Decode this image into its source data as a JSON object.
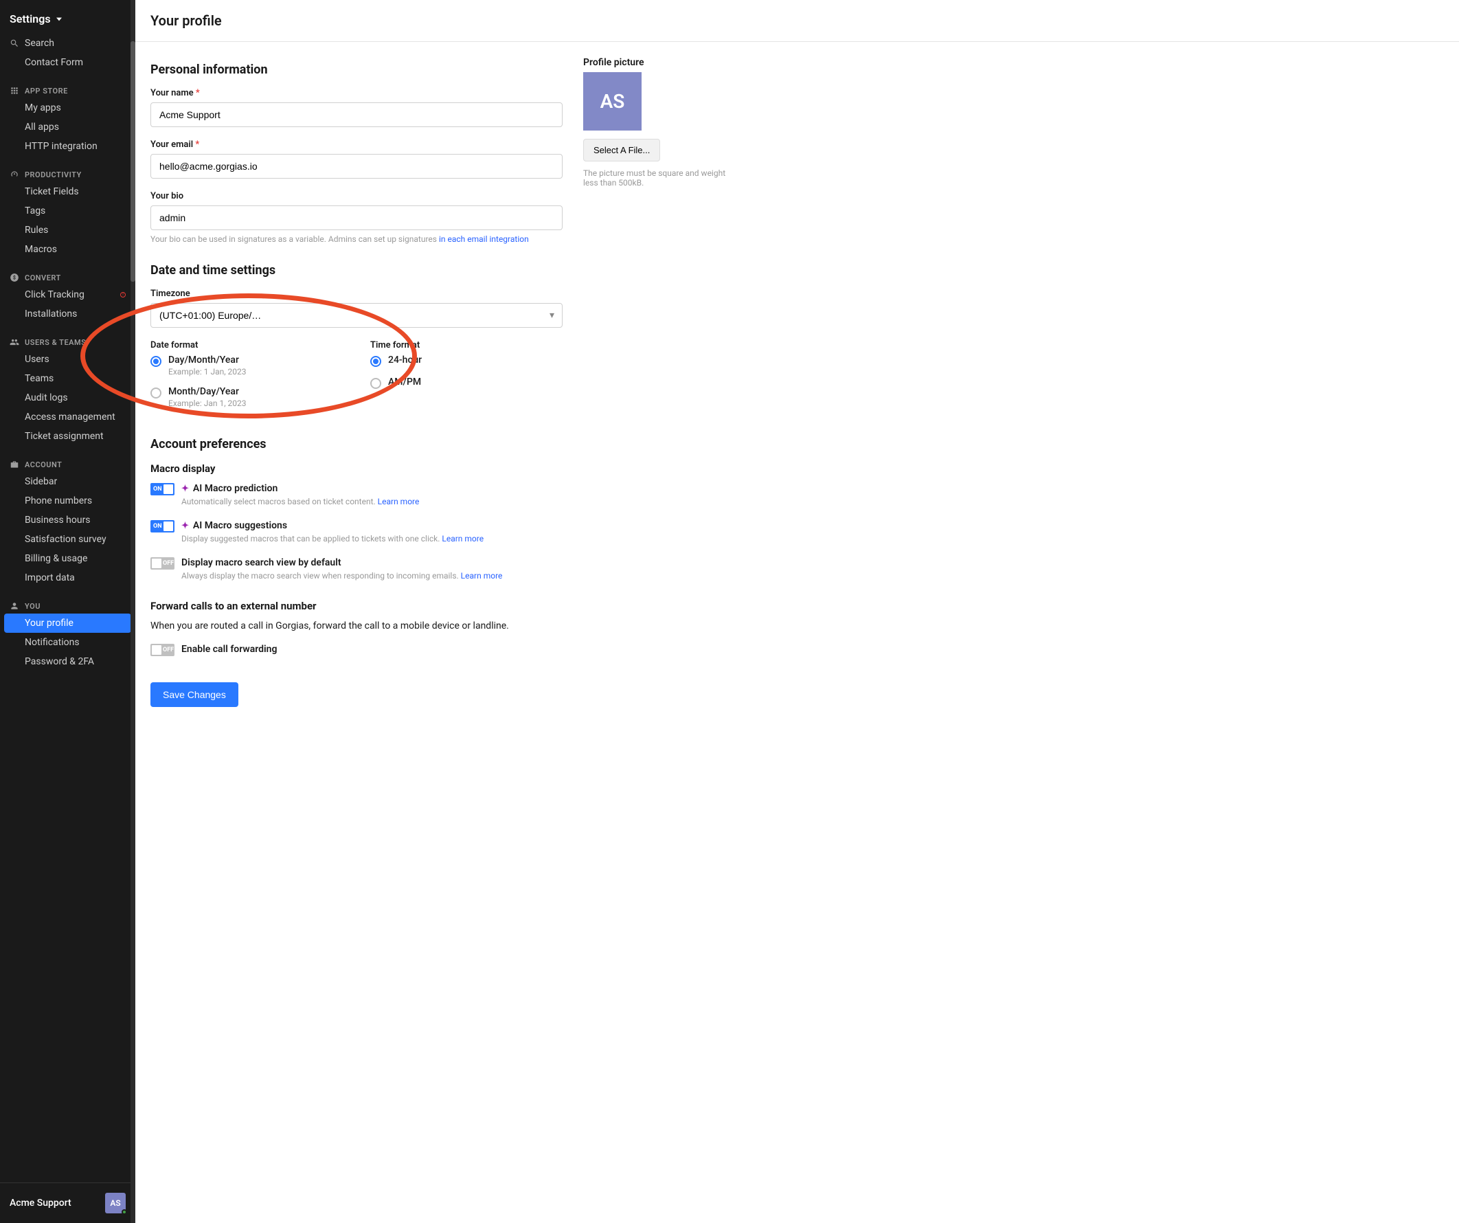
{
  "sidebar": {
    "title": "Settings",
    "top_items": [
      {
        "label": "Search"
      },
      {
        "label": "Contact Form"
      }
    ],
    "sections": [
      {
        "label": "APP STORE",
        "items": [
          {
            "label": "My apps"
          },
          {
            "label": "All apps"
          },
          {
            "label": "HTTP integration"
          }
        ]
      },
      {
        "label": "PRODUCTIVITY",
        "items": [
          {
            "label": "Ticket Fields"
          },
          {
            "label": "Tags"
          },
          {
            "label": "Rules"
          },
          {
            "label": "Macros"
          }
        ]
      },
      {
        "label": "CONVERT",
        "items": [
          {
            "label": "Click Tracking",
            "badge": true
          },
          {
            "label": "Installations"
          }
        ]
      },
      {
        "label": "USERS & TEAMS",
        "items": [
          {
            "label": "Users"
          },
          {
            "label": "Teams"
          },
          {
            "label": "Audit logs"
          },
          {
            "label": "Access management"
          },
          {
            "label": "Ticket assignment"
          }
        ]
      },
      {
        "label": "ACCOUNT",
        "items": [
          {
            "label": "Sidebar"
          },
          {
            "label": "Phone numbers"
          },
          {
            "label": "Business hours"
          },
          {
            "label": "Satisfaction survey"
          },
          {
            "label": "Billing & usage"
          },
          {
            "label": "Import data"
          }
        ]
      },
      {
        "label": "YOU",
        "items": [
          {
            "label": "Your profile",
            "active": true
          },
          {
            "label": "Notifications"
          },
          {
            "label": "Password & 2FA"
          }
        ]
      }
    ],
    "footer": {
      "org_name": "Acme Support",
      "avatar_initials": "AS"
    }
  },
  "page": {
    "title": "Your profile",
    "personal_info": {
      "heading": "Personal information",
      "name_label": "Your name",
      "name_value": "Acme Support",
      "email_label": "Your email",
      "email_value": "hello@acme.gorgias.io",
      "bio_label": "Your bio",
      "bio_value": "admin",
      "bio_hint_prefix": "Your bio can be used in signatures as a variable. Admins can set up signatures ",
      "bio_hint_link": "in each email integration"
    },
    "date_time": {
      "heading": "Date and time settings",
      "timezone_label": "Timezone",
      "timezone_value": "(UTC+01:00) Europe/…",
      "date_format_label": "Date format",
      "date_opt1_label": "Day/Month/Year",
      "date_opt1_example": "Example: 1 Jan, 2023",
      "date_opt2_label": "Month/Day/Year",
      "date_opt2_example": "Example: Jan 1, 2023",
      "time_format_label": "Time format",
      "time_opt1_label": "24-hour",
      "time_opt2_label": "AM/PM"
    },
    "account_prefs": {
      "heading": "Account preferences",
      "macro_display_heading": "Macro display",
      "toggles": [
        {
          "on": true,
          "ai": true,
          "title": "AI Macro prediction",
          "desc_prefix": "Automatically select macros based on ticket content. ",
          "learn_more": "Learn more"
        },
        {
          "on": true,
          "ai": true,
          "title": "AI Macro suggestions",
          "desc_prefix": "Display suggested macros that can be applied to tickets with one click. ",
          "learn_more": "Learn more"
        },
        {
          "on": false,
          "ai": false,
          "title": "Display macro search view by default",
          "desc_prefix": "Always display the macro search view when responding to incoming emails. ",
          "learn_more": "Learn more"
        }
      ],
      "forward_heading": "Forward calls to an external number",
      "forward_desc": "When you are routed a call in Gorgias, forward the call to a mobile device or landline.",
      "forward_toggle_label": "Enable call forwarding",
      "forward_toggle_on": false,
      "save_label": "Save Changes"
    },
    "profile_picture": {
      "heading": "Profile picture",
      "initials": "AS",
      "select_file_label": "Select A File...",
      "hint": "The picture must be square and weight less than 500kB."
    },
    "toggle_on_text": "ON",
    "toggle_off_text": "OFF"
  }
}
